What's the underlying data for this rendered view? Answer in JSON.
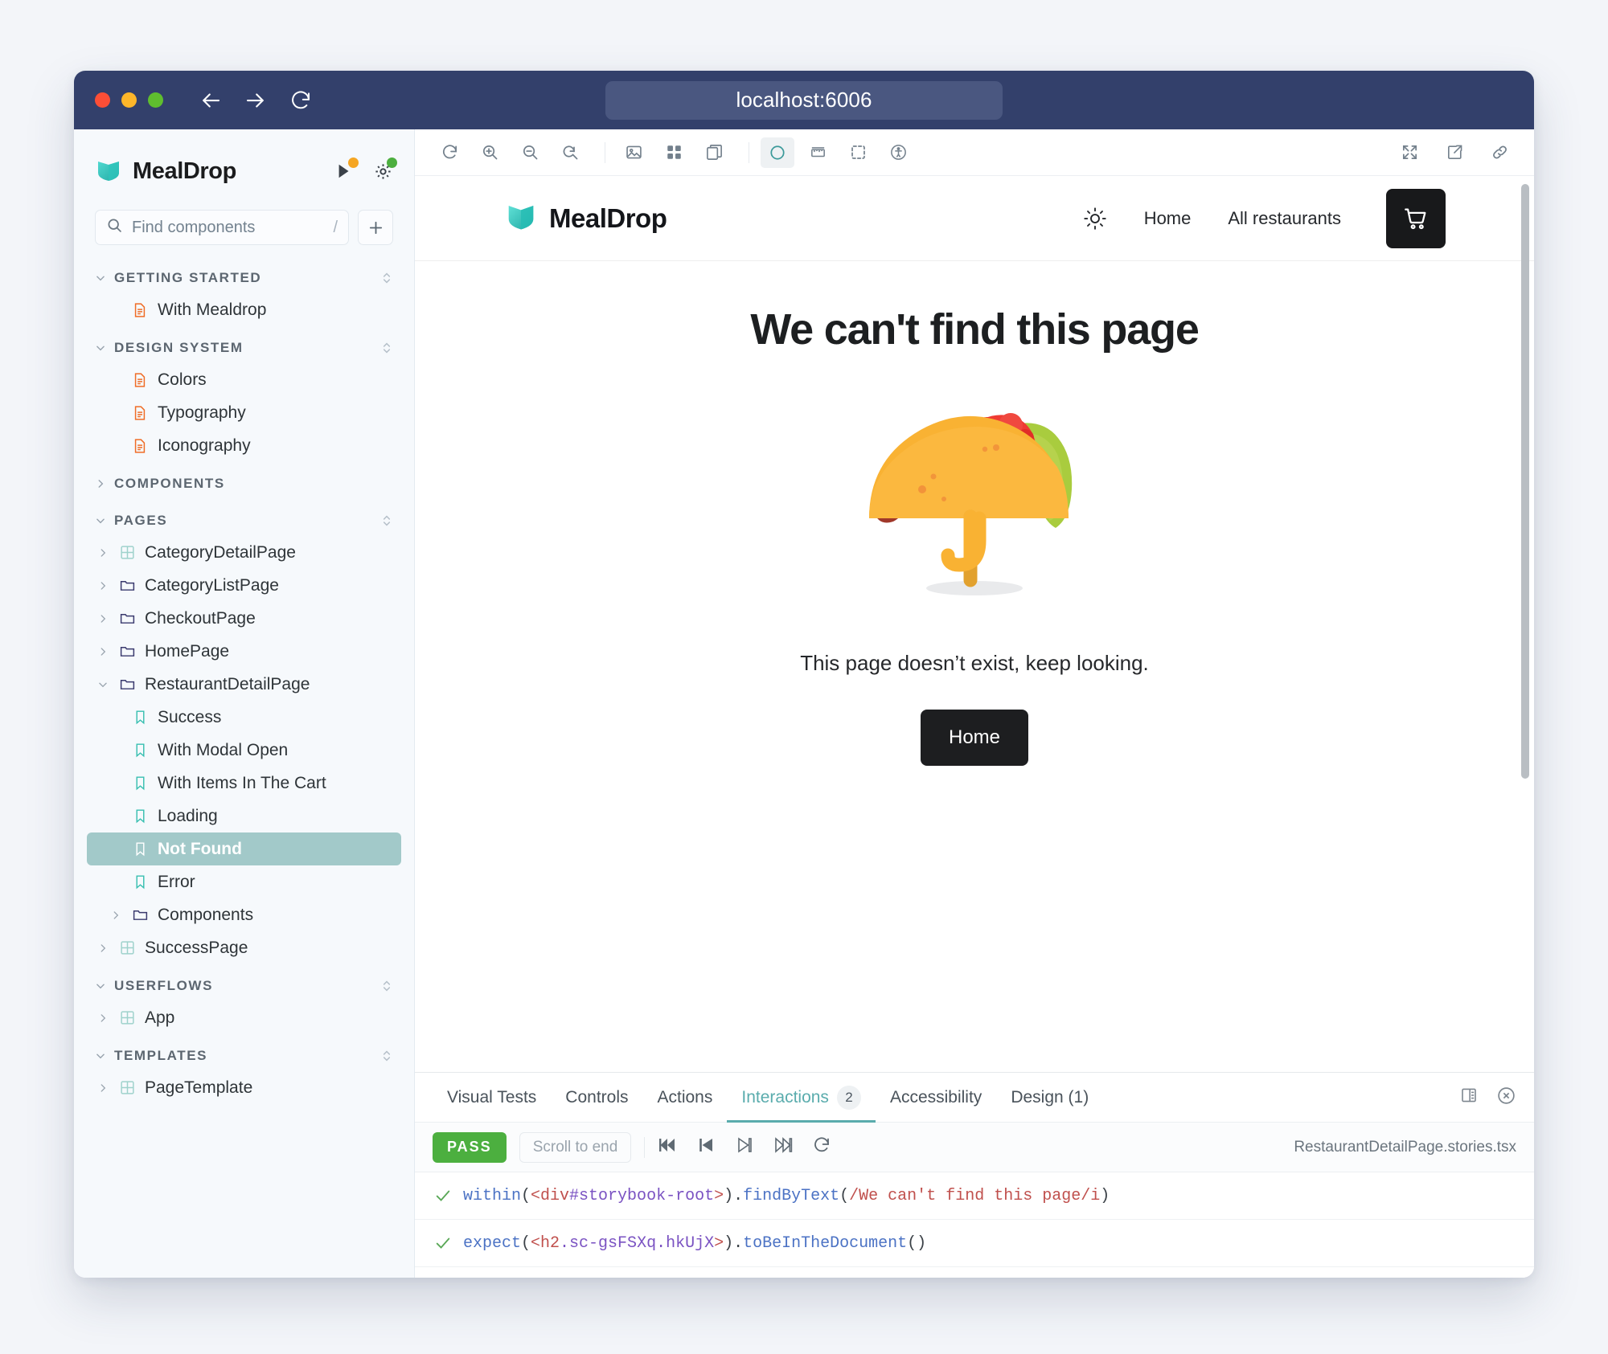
{
  "browser": {
    "url": "localhost:6006",
    "back_label": "Back",
    "forward_label": "Forward",
    "reload_label": "Reload"
  },
  "sidebar": {
    "brand": "MealDrop",
    "publish_label": "Publish",
    "settings_label": "Settings",
    "search": {
      "placeholder": "Find components",
      "shortcut": "/"
    },
    "add_label": "Add",
    "sections": [
      {
        "title": "GETTING STARTED",
        "expanded": true,
        "items": [
          {
            "label": "With Mealdrop",
            "icon": "doc-icon",
            "depth": 1,
            "twisty": "",
            "selected": false
          }
        ]
      },
      {
        "title": "DESIGN SYSTEM",
        "expanded": true,
        "items": [
          {
            "label": "Colors",
            "icon": "doc-icon",
            "depth": 1,
            "twisty": "",
            "selected": false
          },
          {
            "label": "Typography",
            "icon": "doc-icon",
            "depth": 1,
            "twisty": "",
            "selected": false
          },
          {
            "label": "Iconography",
            "icon": "doc-icon",
            "depth": 1,
            "twisty": "",
            "selected": false
          }
        ]
      },
      {
        "title": "COMPONENTS",
        "expanded": false,
        "items": []
      },
      {
        "title": "PAGES",
        "expanded": true,
        "items": [
          {
            "label": "CategoryDetailPage",
            "icon": "component-icon",
            "depth": 0,
            "twisty": "right",
            "selected": false
          },
          {
            "label": "CategoryListPage",
            "icon": "folder-icon",
            "depth": 0,
            "twisty": "right",
            "selected": false
          },
          {
            "label": "CheckoutPage",
            "icon": "folder-icon",
            "depth": 0,
            "twisty": "right",
            "selected": false
          },
          {
            "label": "HomePage",
            "icon": "folder-icon",
            "depth": 0,
            "twisty": "right",
            "selected": false
          },
          {
            "label": "RestaurantDetailPage",
            "icon": "folder-icon",
            "depth": 0,
            "twisty": "down",
            "selected": false
          },
          {
            "label": "Success",
            "icon": "story-icon",
            "depth": 1,
            "twisty": "",
            "selected": false
          },
          {
            "label": "With Modal Open",
            "icon": "story-icon",
            "depth": 1,
            "twisty": "",
            "selected": false
          },
          {
            "label": "With Items In The Cart",
            "icon": "story-icon",
            "depth": 1,
            "twisty": "",
            "selected": false
          },
          {
            "label": "Loading",
            "icon": "story-icon",
            "depth": 1,
            "twisty": "",
            "selected": false
          },
          {
            "label": "Not Found",
            "icon": "story-icon",
            "depth": 1,
            "twisty": "",
            "selected": true
          },
          {
            "label": "Error",
            "icon": "story-icon",
            "depth": 1,
            "twisty": "",
            "selected": false
          },
          {
            "label": "Components",
            "icon": "folder-icon",
            "depth": 1,
            "twisty": "right",
            "selected": false
          },
          {
            "label": "SuccessPage",
            "icon": "component-icon",
            "depth": 0,
            "twisty": "right",
            "selected": false
          }
        ]
      },
      {
        "title": "USERFLOWS",
        "expanded": true,
        "items": [
          {
            "label": "App",
            "icon": "component-icon",
            "depth": 0,
            "twisty": "right",
            "selected": false
          }
        ]
      },
      {
        "title": "TEMPLATES",
        "expanded": true,
        "items": [
          {
            "label": "PageTemplate",
            "icon": "component-icon",
            "depth": 0,
            "twisty": "right",
            "selected": false
          }
        ]
      }
    ]
  },
  "toolbar": {
    "left": [
      {
        "name": "remount-icon",
        "title": "Remount component"
      },
      {
        "name": "zoom-in-icon",
        "title": "Zoom in"
      },
      {
        "name": "zoom-out-icon",
        "title": "Zoom out"
      },
      {
        "name": "zoom-reset-icon",
        "title": "Reset zoom"
      },
      {
        "name": "separator",
        "title": ""
      },
      {
        "name": "background-icon",
        "title": "Change background"
      },
      {
        "name": "grid-icon",
        "title": "Apply a grid"
      },
      {
        "name": "viewport-icon",
        "title": "Change viewport"
      },
      {
        "name": "separator",
        "title": ""
      },
      {
        "name": "theme-circle-icon",
        "title": "Theme",
        "active": true
      },
      {
        "name": "measure-icon",
        "title": "Measure"
      },
      {
        "name": "outline-icon",
        "title": "Outline"
      },
      {
        "name": "accessibility-icon",
        "title": "Accessibility"
      }
    ],
    "right": [
      {
        "name": "fullscreen-icon",
        "title": "Go full screen"
      },
      {
        "name": "open-new-tab-icon",
        "title": "Open canvas in new tab"
      },
      {
        "name": "copy-link-icon",
        "title": "Copy canvas link"
      }
    ]
  },
  "preview": {
    "brand": "MealDrop",
    "theme_toggle_label": "Toggle theme",
    "nav": [
      {
        "label": "Home"
      },
      {
        "label": "All restaurants"
      }
    ],
    "cart_label": "Cart",
    "not_found": {
      "title": "We can't find this page",
      "illustration": "taco-umbrella-illustration",
      "subtitle": "This page doesn’t exist, keep looking.",
      "button": "Home"
    }
  },
  "addon": {
    "tabs": [
      {
        "label": "Visual Tests",
        "count": "",
        "active": false
      },
      {
        "label": "Controls",
        "count": "",
        "active": false
      },
      {
        "label": "Actions",
        "count": "",
        "active": false
      },
      {
        "label": "Interactions",
        "count": "2",
        "active": true
      },
      {
        "label": "Accessibility",
        "count": "",
        "active": false
      },
      {
        "label": "Design (1)",
        "count": "",
        "active": false
      }
    ],
    "layout_label": "Change addon orientation",
    "close_label": "Hide addons",
    "status": "PASS",
    "scroll_to_end": "Scroll to end",
    "controls": [
      {
        "name": "go-start-icon",
        "title": "Go to start"
      },
      {
        "name": "step-back-icon",
        "title": "Step back"
      },
      {
        "name": "step-forward-icon",
        "title": "Step forward"
      },
      {
        "name": "go-end-icon",
        "title": "Go to end"
      },
      {
        "name": "rerun-icon",
        "title": "Rerun"
      }
    ],
    "file_name": "RestaurantDetailPage.stories.tsx",
    "rows": [
      {
        "status": "pass",
        "tokens": [
          {
            "t": "within",
            "c": "fn"
          },
          {
            "t": "(",
            "c": "punct"
          },
          {
            "t": "<div",
            "c": "tag"
          },
          {
            "t": "#storybook-root",
            "c": "attr"
          },
          {
            "t": ">",
            "c": "tag"
          },
          {
            "t": ")",
            "c": "punct"
          },
          {
            "t": ".",
            "c": "punct"
          },
          {
            "t": "findByText",
            "c": "fn"
          },
          {
            "t": "(",
            "c": "punct"
          },
          {
            "t": "/We can't find this page/i",
            "c": "str"
          },
          {
            "t": ")",
            "c": "punct"
          }
        ]
      },
      {
        "status": "pass",
        "tokens": [
          {
            "t": "expect",
            "c": "fn"
          },
          {
            "t": "(",
            "c": "punct"
          },
          {
            "t": "<h2",
            "c": "tag"
          },
          {
            "t": ".sc-gsFSXq.hkUjX",
            "c": "attr"
          },
          {
            "t": ">",
            "c": "tag"
          },
          {
            "t": ")",
            "c": "punct"
          },
          {
            "t": ".",
            "c": "punct"
          },
          {
            "t": "toBeInTheDocument",
            "c": "fn"
          },
          {
            "t": "()",
            "c": "punct"
          }
        ]
      }
    ]
  },
  "colors": {
    "titlebar": "#33406b",
    "accent_teal": "#5aacad",
    "selected_item": "#a2c9c9",
    "pass_green": "#4caf3f",
    "story_icon": "#37bfb0",
    "doc_icon": "#ef6c26",
    "folder_icon": "#3a3a6e",
    "component_icon": "#9fd2cc"
  }
}
